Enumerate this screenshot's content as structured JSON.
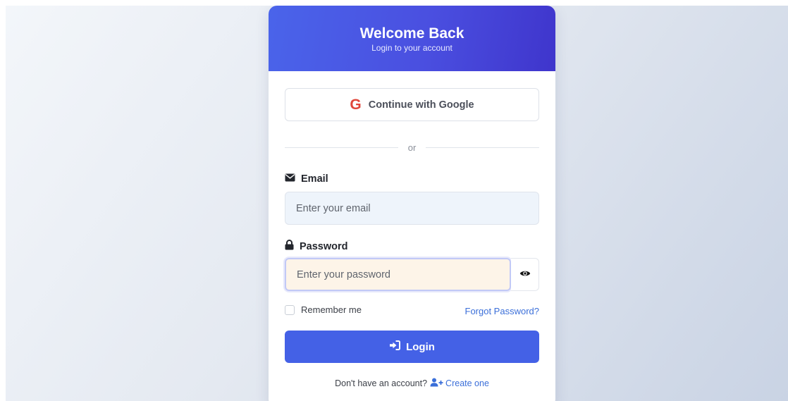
{
  "header": {
    "title": "Welcome Back",
    "subtitle": "Login to your account"
  },
  "google": {
    "icon_letter": "G",
    "label": "Continue with Google"
  },
  "divider_text": "or",
  "email": {
    "label": "Email",
    "icon": "envelope-icon",
    "placeholder": "Enter your email",
    "value": ""
  },
  "password": {
    "label": "Password",
    "icon": "lock-icon",
    "placeholder": "Enter your password",
    "value": "",
    "toggle_icon": "eye-icon"
  },
  "remember_me": {
    "label": "Remember me",
    "checked": false
  },
  "forgot_password": "Forgot Password?",
  "login_button": {
    "label": "Login",
    "icon": "sign-in-icon"
  },
  "signup": {
    "prompt": "Don't have an account?",
    "link": "Create one",
    "icon": "user-plus-icon"
  },
  "colors": {
    "header_gradient_start": "#4a64ea",
    "header_gradient_end": "#3f35cc",
    "primary_button": "#4461e6",
    "link": "#3b6fd9",
    "google_red": "#e0463a",
    "email_input_bg": "#eef4fb",
    "password_input_bg": "#fdf4e8"
  }
}
